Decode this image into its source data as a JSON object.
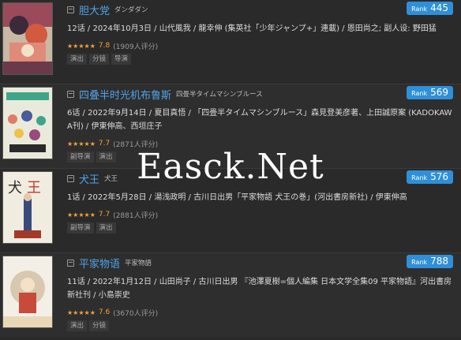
{
  "items": [
    {
      "title": "胆大党",
      "jp_title": "ダンダダン",
      "rank_label": "Rank",
      "rank": "445",
      "meta": "12话 / 2024年10月3日 / 山代風我 / 龍幸伸 (集英社「少年ジャンプ+」連載) / 恩田尚之; 副人设: 野田猛",
      "stars": "★★★★★",
      "score": "7.8",
      "votes": "(1909人评分)",
      "tags": [
        "演出",
        "分镜",
        "导演"
      ]
    },
    {
      "title": "四叠半时光机布鲁斯",
      "jp_title": "四畳半タイムマシンブルース",
      "rank_label": "Rank",
      "rank": "569",
      "meta": "6话 / 2022年9月14日 / 夏目真悟 / 「四畳半タイムマシンブルース」森見登美彦著、上田誠原案 (KADOKAWA刊) / 伊東伸高、西垣庄子",
      "stars": "★★★★★",
      "score": "7.7",
      "votes": "(2871人评分)",
      "tags": [
        "副导演",
        "演出"
      ]
    },
    {
      "title": "犬王",
      "jp_title": "犬王",
      "rank_label": "Rank",
      "rank": "576",
      "meta": "1话 / 2022年5月28日 / 湯浅政明 / 古川日出男「平家物語 犬王の巻」(河出書房新社) / 伊東伸高",
      "stars": "★★★★★",
      "score": "7.7",
      "votes": "(2881人评分)",
      "tags": [
        "副导演",
        "演出"
      ]
    },
    {
      "title": "平家物语",
      "jp_title": "平家物語",
      "rank_label": "Rank",
      "rank": "788",
      "meta": "11话 / 2022年1月12日 / 山田尚子 / 古川日出男 『池澤夏樹=個人編集 日本文学全集09 平家物語』河出書房新社刊 / 小島崇史",
      "stars": "★★★★★",
      "score": "7.6",
      "votes": "(3670人评分)",
      "tags": [
        "演出",
        "分镜"
      ]
    }
  ],
  "watermark": "Easck.Net",
  "colors": {
    "accent": "#4fa3e8",
    "rank_bg": "#2f8fd8",
    "star": "#f2a33a",
    "bg": "#2a2a2a"
  }
}
